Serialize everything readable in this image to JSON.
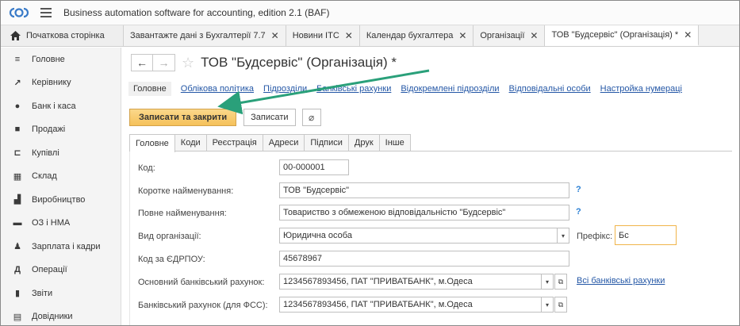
{
  "app": {
    "title": "Business automation software for accounting, edition 2.1  (BAF)"
  },
  "tabs": {
    "home": "Початкова сторінка",
    "items": [
      {
        "label": "Завантажте дані з Бухгалтерії 7.7"
      },
      {
        "label": "Новини ІТС"
      },
      {
        "label": "Календар бухгалтера"
      },
      {
        "label": "Організації"
      },
      {
        "label": "ТОВ \"Будсервіс\" (Організація) *"
      }
    ]
  },
  "sidebar": {
    "items": [
      {
        "label": "Головне",
        "icon": "menu-icon"
      },
      {
        "label": "Керівнику",
        "icon": "trend-icon"
      },
      {
        "label": "Банк і каса",
        "icon": "coins-icon"
      },
      {
        "label": "Продажі",
        "icon": "bag-icon"
      },
      {
        "label": "Купівлі",
        "icon": "cart-icon"
      },
      {
        "label": "Склад",
        "icon": "warehouse-icon"
      },
      {
        "label": "Виробництво",
        "icon": "factory-icon"
      },
      {
        "label": "ОЗ і НМА",
        "icon": "truck-icon"
      },
      {
        "label": "Зарплата і кадри",
        "icon": "person-icon"
      },
      {
        "label": "Операції",
        "icon": "operations-icon"
      },
      {
        "label": "Звіти",
        "icon": "bar-chart-icon"
      },
      {
        "label": "Довідники",
        "icon": "book-icon"
      }
    ]
  },
  "document": {
    "title": "ТОВ \"Будсервіс\" (Організація) *",
    "sections": {
      "current": "Головне",
      "links": [
        "Облікова політика",
        "Підрозділи",
        "Банківські рахунки",
        "Відокремлені підрозділи",
        "Відповідальні особи",
        "Настройка нумераці"
      ]
    },
    "buttons": {
      "save_close": "Записати та закрити",
      "save": "Записати"
    },
    "subtabs": [
      "Головне",
      "Коди",
      "Реєстрація",
      "Адреси",
      "Підписи",
      "Друк",
      "Інше"
    ],
    "form": {
      "code_label": "Код:",
      "code_value": "00-000001",
      "short_name_label": "Коротке найменування:",
      "short_name_value": "ТОВ \"Будсервіс\"",
      "full_name_label": "Повне найменування:",
      "full_name_value": "Товариство з обмеженою відповідальністю \"Будсервіс\"",
      "help": "?",
      "org_type_label": "Вид організації:",
      "org_type_value": "Юридична особа",
      "prefix_label": "Префікс:",
      "prefix_value": "Бс",
      "edrpou_label": "Код за ЄДРПОУ:",
      "edrpou_value": "45678967",
      "main_account_label": "Основний банківський рахунок:",
      "main_account_value": "1234567893456, ПАТ \"ПРИВАТБАНК\", м.Одеса",
      "all_accounts_link": "Всі банківські рахунки",
      "fss_account_label": "Банківський рахунок (для ФСС):",
      "fss_account_value": "1234567893456, ПАТ \"ПРИВАТБАНК\", м.Одеса"
    }
  },
  "colors": {
    "accent": "#f5c15a",
    "link": "#2457a6",
    "arrow": "#2aa07a"
  }
}
